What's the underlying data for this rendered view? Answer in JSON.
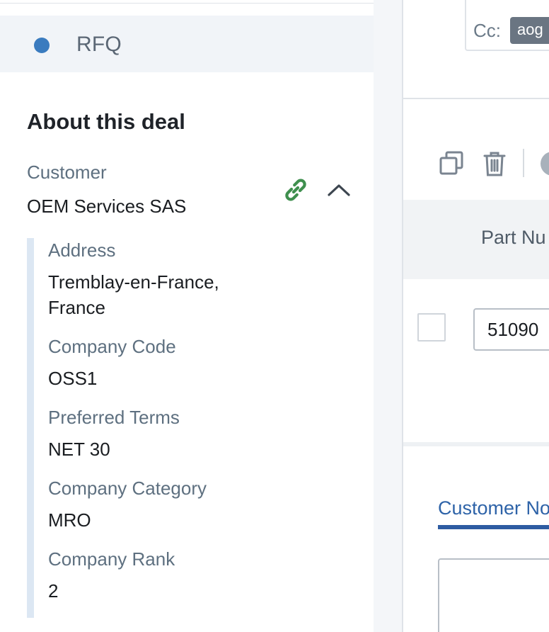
{
  "stage": {
    "label": "RFQ",
    "dot_color": "#3a7bbf"
  },
  "about": {
    "title": "About this deal",
    "customer_label": "Customer",
    "customer_value": "OEM Services SAS",
    "icons": {
      "link": "link-icon",
      "collapse": "chevron-up-icon"
    },
    "fields": [
      {
        "label": "Address",
        "value_line1": "Tremblay-en-France,",
        "value_line2": "France"
      },
      {
        "label": "Company Code",
        "value": "OSS1"
      },
      {
        "label": "Preferred Terms",
        "value": "NET 30"
      },
      {
        "label": "Company Category",
        "value": "MRO"
      },
      {
        "label": "Company Rank",
        "value": "2"
      }
    ]
  },
  "email": {
    "cc_label": "Cc:",
    "cc_chip": "aog"
  },
  "toolbar": {
    "icons": [
      "copy-icon",
      "trash-icon"
    ]
  },
  "table": {
    "column_header": "Part Nu",
    "row": {
      "part_number": "51090"
    }
  },
  "notes": {
    "tab_label": "Customer No"
  },
  "colors": {
    "link_green": "#3f8f4e",
    "accent_blue": "#2e5ca2"
  }
}
